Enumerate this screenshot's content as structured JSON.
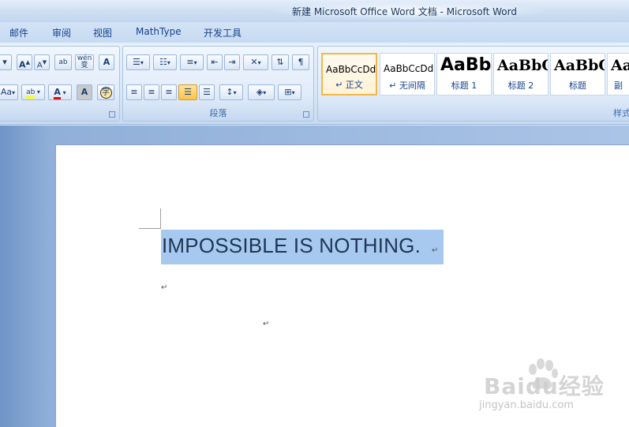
{
  "window": {
    "title": "新建 Microsoft Office Word 文档 - Microsoft Word"
  },
  "tabs": [
    "邮件",
    "审阅",
    "视图",
    "MathType",
    "开发工具"
  ],
  "ribbon": {
    "font_group": {
      "grow_label": "A",
      "shrink_label": "A",
      "clear_format_label": "ab",
      "phonetic_label": "wén 变",
      "char_border_label": "A",
      "change_case_label": "Aa",
      "highlight_label": "ab",
      "font_color_label": "A",
      "char_shading_label": "A",
      "enclose_label": "字"
    },
    "paragraph_group": {
      "label": "段落"
    },
    "styles_group": {
      "label": "样式",
      "items": [
        {
          "sample": "AaBbCcDd",
          "name": "↵ 正文"
        },
        {
          "sample": "AaBbCcDd",
          "name": "↵ 无间隔"
        },
        {
          "sample": "AaBb",
          "name": "标题 1"
        },
        {
          "sample": "AaBbC",
          "name": "标题 2"
        },
        {
          "sample": "AaBbC",
          "name": "标题"
        },
        {
          "sample": "Aa",
          "name": "副"
        }
      ]
    }
  },
  "document": {
    "line1": "IMPOSSIBLE IS NOTHING.",
    "paragraph_mark": "↵"
  },
  "watermark": {
    "brand": "Baidu经验",
    "url": "jingyan.baidu.com"
  },
  "colors": {
    "highlight": "#ffff00",
    "font_color": "#ff0000",
    "selection": "#a7c9ef",
    "selected_style_border": "#f2b749"
  }
}
